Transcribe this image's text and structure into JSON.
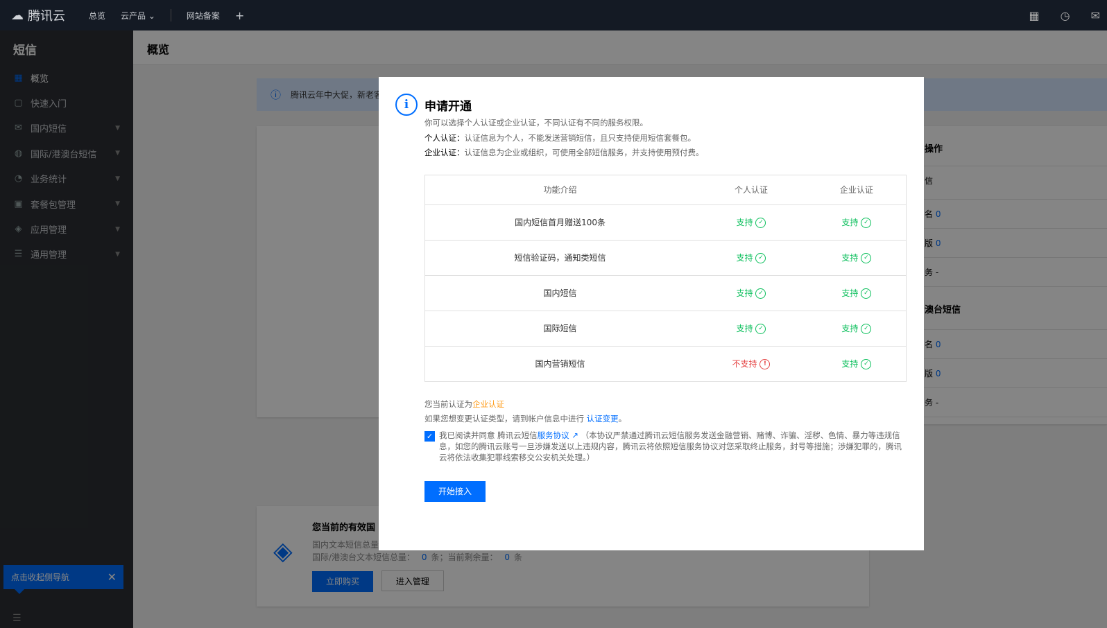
{
  "topbar": {
    "brand": "腾讯云",
    "nav": [
      "总览",
      "云产品",
      "网站备案"
    ],
    "add": "+"
  },
  "sidebar": {
    "title": "短信",
    "items": [
      {
        "label": "概览",
        "icon": "grid"
      },
      {
        "label": "快速入门",
        "icon": "book"
      },
      {
        "label": "国内短信",
        "icon": "mail"
      },
      {
        "label": "国际/港澳台短信",
        "icon": "globe"
      },
      {
        "label": "业务统计",
        "icon": "pie"
      },
      {
        "label": "套餐包管理",
        "icon": "package"
      },
      {
        "label": "应用管理",
        "icon": "layers"
      },
      {
        "label": "通用管理",
        "icon": "sliders"
      }
    ],
    "collapse_tip": "点击收起侧导航"
  },
  "page": {
    "title": "概览",
    "banner": "腾讯云年中大促，新老客",
    "right_panel": {
      "title": "操作",
      "sec1": "信",
      "rows1": [
        {
          "l": "名",
          "v": "0"
        },
        {
          "l": "版",
          "v": "0"
        },
        {
          "l": "务",
          "v": "-"
        }
      ],
      "sec2": "澳台短信",
      "rows2": [
        {
          "l": "名",
          "v": "0"
        },
        {
          "l": "版",
          "v": "0"
        },
        {
          "l": "务",
          "v": "-"
        }
      ]
    },
    "package": {
      "title": "您当前的有效国",
      "line1": "国内文本短信总量",
      "line2_label": "国际/港澳台文本短信总量：",
      "line2_total": "0",
      "unit": "条",
      "line2_rem_label": "；当前剩余量：",
      "line2_rem": "0",
      "buy": "立即购买",
      "manage": "进入管理"
    }
  },
  "modal": {
    "title": "申请开通",
    "intro": "你可以选择个人认证或企业认证，不同认证有不同的服务权限。",
    "personal_label": "个人认证：",
    "personal_desc": "认证信息为个人，不能发送营销短信，且只支持使用短信套餐包。",
    "enterprise_label": "企业认证：",
    "enterprise_desc": "认证信息为企业或组织，可使用全部短信服务，并支持使用预付费。",
    "table": {
      "headers": [
        "功能介绍",
        "个人认证",
        "企业认证"
      ],
      "rows": [
        [
          "国内短信首月赠送100条",
          "支持",
          "支持"
        ],
        [
          "短信验证码，通知类短信",
          "支持",
          "支持"
        ],
        [
          "国内短信",
          "支持",
          "支持"
        ],
        [
          "国际短信",
          "支持",
          "支持"
        ],
        [
          "国内营销短信",
          "不支持",
          "支持"
        ]
      ]
    },
    "current_prefix": "您当前认证为",
    "current_value": "企业认证",
    "change_text": "如果您想变更认证类型，请到帐户信息中进行 ",
    "change_link": "认证变更",
    "change_end": "。",
    "agree_prefix": "我已阅读并同意 腾讯云短信",
    "agree_link": "服务协议",
    "agree_text": "（本协议严禁通过腾讯云短信服务发送金融营销、赌博、诈骗、淫秽、色情、暴力等违规信息，如您的腾讯云账号一旦涉嫌发送以上违规内容，腾讯云将依照短信服务协议对您采取终止服务，封号等措施；涉嫌犯罪的，腾讯云将依法收集犯罪线索移交公安机关处理。）",
    "agree_checked": true,
    "start_button": "开始接入"
  }
}
